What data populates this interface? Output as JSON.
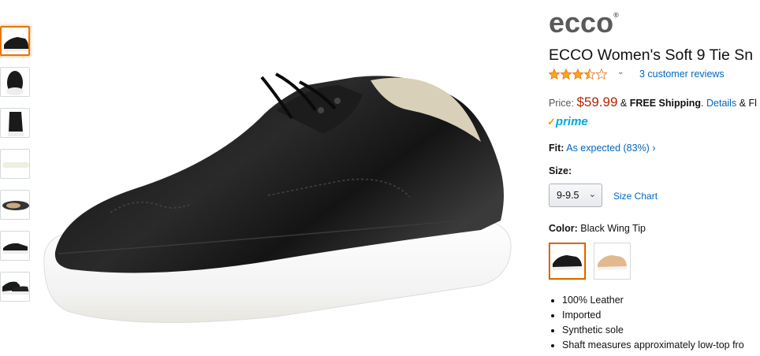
{
  "product": {
    "brand": "ECCO",
    "title": "ECCO Women's Soft 9 Tie Sn",
    "rating_out_of_5": 3.5,
    "reviews_label": "3 customer reviews",
    "price_label": "Price:",
    "price": "$59.99",
    "shipping_connector": "&",
    "shipping": "FREE Shipping",
    "details_link": "Details",
    "details_suffix": "& Fl",
    "prime": "prime",
    "fit_label": "Fit:",
    "fit_value": "As expected (83%)",
    "fit_chevron": "›",
    "size_label": "Size:",
    "size_value": "9-9.5",
    "size_chart": "Size Chart",
    "color_label": "Color:",
    "color_value": "Black Wing Tip",
    "swatches": [
      {
        "name": "Black Wing Tip",
        "color": "#1a1a1a"
      },
      {
        "name": "Tan",
        "color": "#e2b98f"
      }
    ],
    "bullets": [
      "100% Leather",
      "Imported",
      "Synthetic sole",
      "Shaft measures approximately low-top fro"
    ]
  },
  "thumbnails": [
    {
      "label": "side view",
      "selected": true
    },
    {
      "label": "top view",
      "selected": false
    },
    {
      "label": "front view",
      "selected": false
    },
    {
      "label": "sole view",
      "selected": false
    },
    {
      "label": "pair top",
      "selected": false
    },
    {
      "label": "side alt",
      "selected": false
    },
    {
      "label": "pair side",
      "selected": false
    }
  ],
  "colors": {
    "link": "#0066c0",
    "price": "#b12704",
    "star": "#ffa41c",
    "prime": "#00a8e1",
    "selected_thumb": "#e77600"
  }
}
